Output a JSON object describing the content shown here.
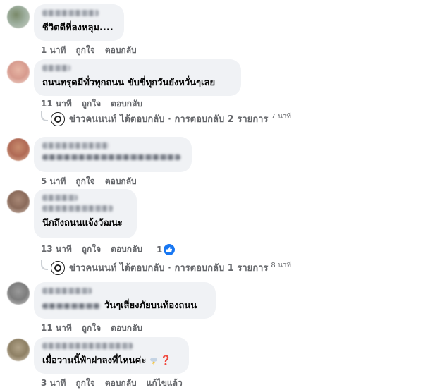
{
  "comments": [
    {
      "text": "ชีวิตดีที่ลงหลุม....",
      "time": "1 นาที",
      "like": "ถูกใจ",
      "reply": "ตอบกลับ"
    },
    {
      "text": "ถนนทรุดมีทั่วทุกถนน ขับขี่ทุกวันยังหวั่นๆเลย",
      "time": "11 นาที",
      "like": "ถูกใจ",
      "reply": "ตอบกลับ"
    },
    {
      "text": "",
      "time": "5 นาที",
      "like": "ถูกใจ",
      "reply": "ตอบกลับ"
    },
    {
      "text": "นึกถึงถนนแจ้งวัฒนะ",
      "time": "13 นาที",
      "like": "ถูกใจ",
      "reply": "ตอบกลับ",
      "reaction_count": "1"
    },
    {
      "text": "วันๆเสี่ยงภัยบนท้องถนน",
      "time": "11 นาที",
      "like": "ถูกใจ",
      "reply": "ตอบกลับ"
    },
    {
      "text": "เมื่อวานนี้ฟ้าผ่าลงที่ไหนค่ะ",
      "text_suffix": "❓",
      "time": "3 นาที",
      "like": "ถูกใจ",
      "reply": "ตอบกลับ",
      "edit": "แก้ไขแล้ว"
    }
  ],
  "reply_summaries": [
    {
      "text": "ข่าวคนนนท์ ได้ตอบกลับ · การตอบกลับ 2 รายการ",
      "time": "7 นาที"
    },
    {
      "text": "ข่าวคนนนท์ ได้ตอบกลับ · การตอบกลับ 1 รายการ",
      "time": "8 นาที"
    }
  ],
  "colors": {
    "bubble": "#f0f2f5",
    "meta": "#65676b",
    "like_blue": "#1877f2"
  }
}
